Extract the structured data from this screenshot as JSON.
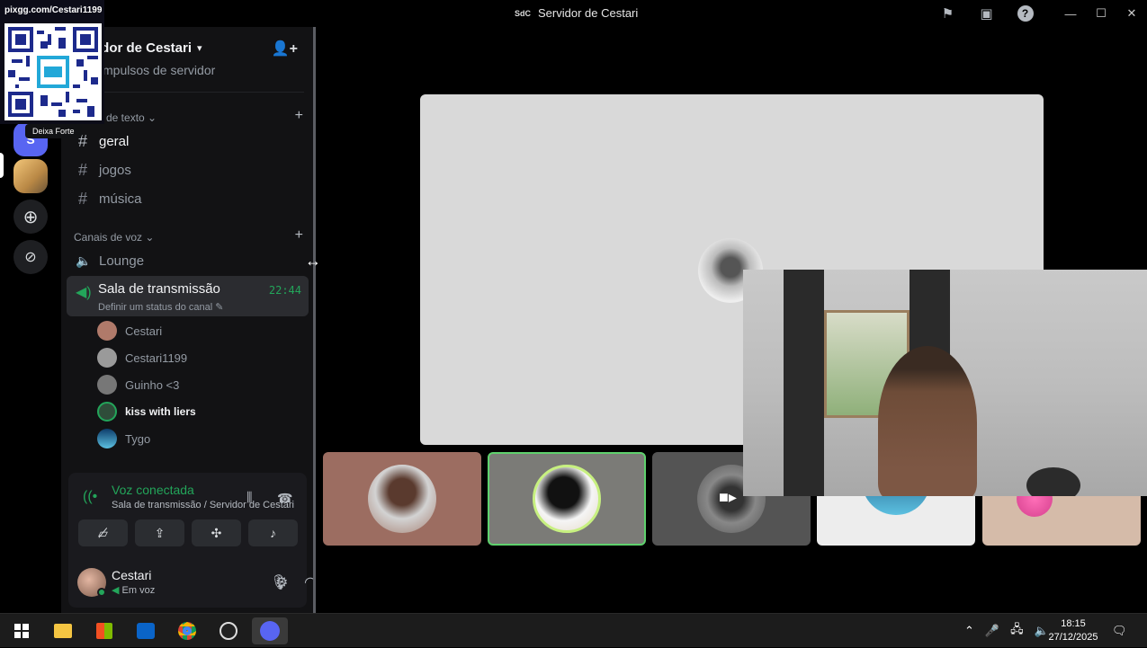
{
  "titlebar": {
    "badge": "SdC",
    "title": "Servidor de Cestari",
    "icons": [
      "inbox-flag-icon",
      "inbox-icon",
      "help-icon"
    ],
    "window_controls": [
      "minimize-icon",
      "maximize-icon",
      "close-icon"
    ]
  },
  "overlay": {
    "url": "pixgg.com/Cestari1199",
    "tooltip": "Deixa Forte"
  },
  "guilds": {
    "selected_initial": "S",
    "add_icon": "plus-icon",
    "discover_icon": "compass-icon"
  },
  "server": {
    "name": "idor de Cestari",
    "boosts": "mpulsos de servidor",
    "text_category": "de texto",
    "voice_category": "Canais de voz",
    "text_channels": [
      "geral",
      "jogos",
      "música"
    ],
    "voice_channels": [
      "Lounge"
    ],
    "active_voice": {
      "name": "Sala de transmissão",
      "time": "22:44",
      "status": "Definir um status do canal"
    },
    "members": [
      {
        "name": "Cestari",
        "color": "#b07a6a"
      },
      {
        "name": "Cestari1199",
        "color": "#9a9a9a"
      },
      {
        "name": "Guinho <3",
        "color": "#777777"
      },
      {
        "name": "kiss with liers",
        "color": "#2f4d3a"
      },
      {
        "name": "Tygo",
        "color": "#3c9ac4"
      }
    ]
  },
  "voice_panel": {
    "title": "Voz conectada",
    "subtitle": "Sala de transmissão / Servidor de Cestari",
    "buttons": [
      "camera-off-icon",
      "screen-share-icon",
      "activities-icon",
      "soundboard-icon"
    ]
  },
  "user": {
    "name": "Cestari",
    "status": "Em voz",
    "controls": [
      "microphone-icon",
      "headphones-icon",
      "settings-icon"
    ]
  },
  "stage": {
    "tiles": [
      {
        "bg": "#9c6d61"
      },
      {
        "bg": "#7b7b77",
        "border": "#5fd16d"
      },
      {
        "bg": "#545454"
      },
      {
        "bg": "#ededed"
      },
      {
        "bg": "#d5bba9"
      }
    ]
  },
  "taskbar": {
    "time": "18:15",
    "date": "27/12/2025"
  },
  "colors": {
    "accent": "#5865f2",
    "voice_green": "#23a55a"
  }
}
